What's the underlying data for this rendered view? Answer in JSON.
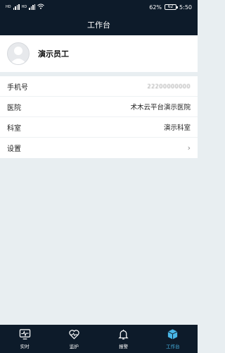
{
  "status_bar": {
    "signal_1_label": "HD",
    "signal_2_label": "HD",
    "battery_percent": "62%",
    "battery_level": "62",
    "time": "5:50"
  },
  "header": {
    "title": "工作台"
  },
  "profile": {
    "name": "演示员工"
  },
  "info_rows": [
    {
      "label": "手机号",
      "value": "22200000000"
    },
    {
      "label": "医院",
      "value": "术木云平台演示医院"
    },
    {
      "label": "科室",
      "value": "演示科室"
    },
    {
      "label": "设置",
      "value": ""
    }
  ],
  "tabs": [
    {
      "label": "实时",
      "icon": "monitor-heartbeat-icon",
      "active": false
    },
    {
      "label": "监护",
      "icon": "heart-icon",
      "active": false
    },
    {
      "label": "报警",
      "icon": "bell-icon",
      "active": false
    },
    {
      "label": "工作台",
      "icon": "cube-icon",
      "active": true
    }
  ],
  "colors": {
    "header_bg": "#0d1b2a",
    "page_bg": "#e8eef1",
    "active_tab": "#48b6e6"
  }
}
